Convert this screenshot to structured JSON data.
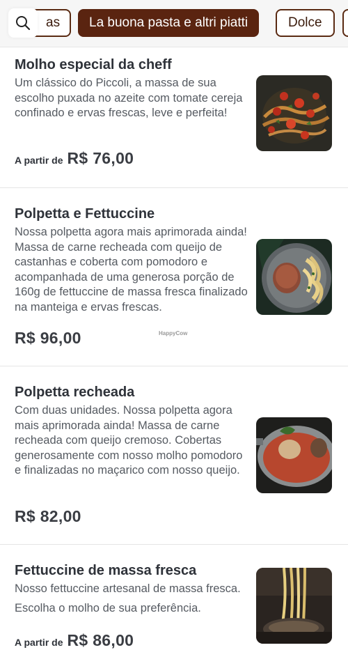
{
  "tabs": {
    "search_icon": "search-icon",
    "items": [
      {
        "label": "as"
      },
      {
        "label": "La buona pasta e altri piatti",
        "active": true
      },
      {
        "label": "Dolce"
      }
    ]
  },
  "watermark": "HappyCow",
  "items": [
    {
      "title": "Molho especial da cheff",
      "desc": "Um clássico do Piccoli, a massa de sua escolho puxada no azeite com tomate cereja confinado e ervas frescas, leve e perfeita!",
      "price_prefix": "A partir de",
      "price": "R$ 76,00",
      "image": "pasta-with-cherry-tomatoes-photo"
    },
    {
      "title": "Polpetta e Fettuccine",
      "desc": "Nossa polpetta agora mais aprimorada ainda! Massa de carne recheada com queijo de castanhas e coberta com pomodoro e acompanhada de uma generosa porção de 160g de fettuccine de massa fresca finalizado na manteiga e ervas frescas.",
      "price": "R$ 96,00",
      "image": "polpetta-and-fettuccine-photo"
    },
    {
      "title": "Polpetta recheada",
      "desc": "Com duas unidades. Nossa polpetta agora mais aprimorada ainda! Massa de carne recheada com queijo cremoso. Cobertas generosamente com nosso molho pomodoro e finalizadas no maçarico com nosso queijo.",
      "price": "R$ 82,00",
      "image": "stuffed-polpetta-pan-photo"
    },
    {
      "title": "Fettuccine de massa fresca",
      "desc": "Nosso fettuccine artesanal de massa fresca.",
      "desc2": "Escolha o molho de sua preferência.",
      "price_prefix": "A partir de",
      "price": "R$ 86,00",
      "image": "fresh-fettuccine-photo"
    }
  ]
}
